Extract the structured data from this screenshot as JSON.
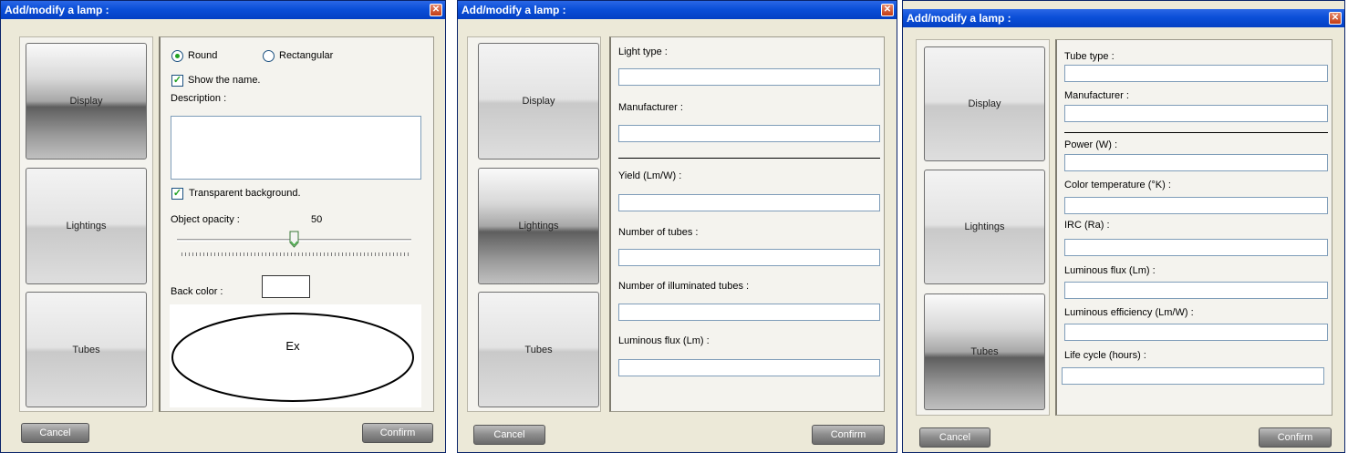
{
  "windows": [
    {
      "title": "Add/modify a lamp :",
      "nav": {
        "display": "Display",
        "lightings": "Lightings",
        "tubes": "Tubes"
      },
      "cancel": "Cancel",
      "confirm": "Confirm",
      "shape_round": "Round",
      "shape_rectangular": "Rectangular",
      "shape_selected": "Round",
      "show_name": "Show the name.",
      "show_name_checked": true,
      "description_label": "Description :",
      "description_value": "",
      "transparent_bg": "Transparent background.",
      "transparent_bg_checked": true,
      "opacity_label": "Object opacity :",
      "opacity_value": "50",
      "back_color_label": "Back color :",
      "back_color": "#ffffff",
      "preview_text": "Ex"
    },
    {
      "title": "Add/modify a lamp :",
      "nav": {
        "display": "Display",
        "lightings": "Lightings",
        "tubes": "Tubes"
      },
      "cancel": "Cancel",
      "confirm": "Confirm",
      "fields": [
        {
          "label": "Light type :",
          "value": ""
        },
        {
          "label": "Manufacturer :",
          "value": ""
        },
        {
          "label": "Yield (Lm/W) :",
          "value": ""
        },
        {
          "label": "Number of tubes :",
          "value": ""
        },
        {
          "label": "Number of illuminated tubes :",
          "value": ""
        },
        {
          "label": "Luminous flux (Lm) :",
          "value": ""
        }
      ]
    },
    {
      "title": "Add/modify a lamp :",
      "nav": {
        "display": "Display",
        "lightings": "Lightings",
        "tubes": "Tubes"
      },
      "cancel": "Cancel",
      "confirm": "Confirm",
      "fields": [
        {
          "label": "Tube type :",
          "value": ""
        },
        {
          "label": "Manufacturer :",
          "value": ""
        },
        {
          "label": "Power (W) :",
          "value": ""
        },
        {
          "label": "Color temperature (°K) :",
          "value": ""
        },
        {
          "label": "IRC (Ra) :",
          "value": ""
        },
        {
          "label": "Luminous flux (Lm) :",
          "value": ""
        },
        {
          "label": "Luminous efficiency (Lm/W) :",
          "value": ""
        },
        {
          "label": "Life cycle (hours) :",
          "value": ""
        }
      ]
    }
  ],
  "colors": {
    "title_bar": "#0b4fd8",
    "dialog_bg": "#ece9d8",
    "panel_bg": "#f4f3ee",
    "field_border": "#7f9db9",
    "check_green": "#21a121"
  },
  "icons": {
    "close": "close-icon",
    "slider_thumb": "slider-thumb-icon"
  }
}
